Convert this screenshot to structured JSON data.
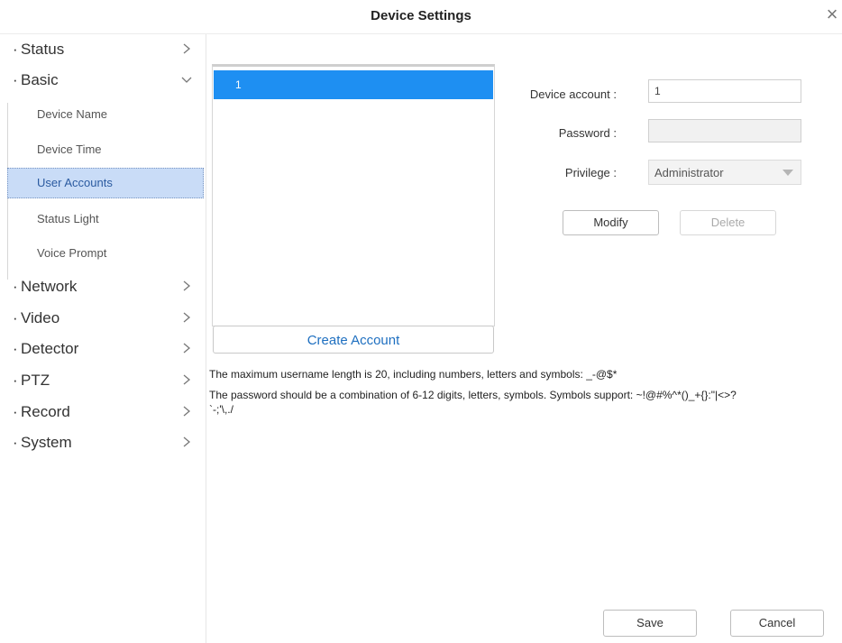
{
  "window": {
    "title": "Device Settings"
  },
  "sidebar": {
    "items": [
      {
        "label": "Status"
      },
      {
        "label": "Basic"
      },
      {
        "label": "Network"
      },
      {
        "label": "Video"
      },
      {
        "label": "Detector"
      },
      {
        "label": "PTZ"
      },
      {
        "label": "Record"
      },
      {
        "label": "System"
      }
    ],
    "basic_sub_items": [
      {
        "label": "Device Name"
      },
      {
        "label": "Device Time"
      },
      {
        "label": "User Accounts",
        "active": true
      },
      {
        "label": "Status Light"
      },
      {
        "label": "Voice Prompt"
      }
    ]
  },
  "accounts": {
    "rows": [
      {
        "label": "1",
        "selected": true
      }
    ],
    "create_label": "Create Account"
  },
  "form": {
    "account_label": "Device account :",
    "account_value": "1",
    "password_label": "Password :",
    "password_value": "",
    "privilege_label": "Privilege :",
    "privilege_value": "Administrator",
    "modify_label": "Modify",
    "delete_label": "Delete"
  },
  "notes": {
    "username_rule": "The maximum username length is 20, including numbers, letters and symbols: _-@$*",
    "password_rule_line1": "The password should be a combination of 6-12 digits, letters, symbols. Symbols support: ~!@#%^*()_+{}:\"|<>?",
    "password_rule_line2": "`-;'\\,./"
  },
  "footer": {
    "save_label": "Save",
    "cancel_label": "Cancel"
  },
  "colors": {
    "accent": "#1e8ff2",
    "active_bg": "#c9dcf7",
    "link": "#1e6fc0"
  },
  "icons": {
    "close": "close-icon",
    "chevron_right": "chevron-right-icon",
    "chevron_down": "chevron-down-icon",
    "dropdown": "dropdown-arrow-icon"
  }
}
